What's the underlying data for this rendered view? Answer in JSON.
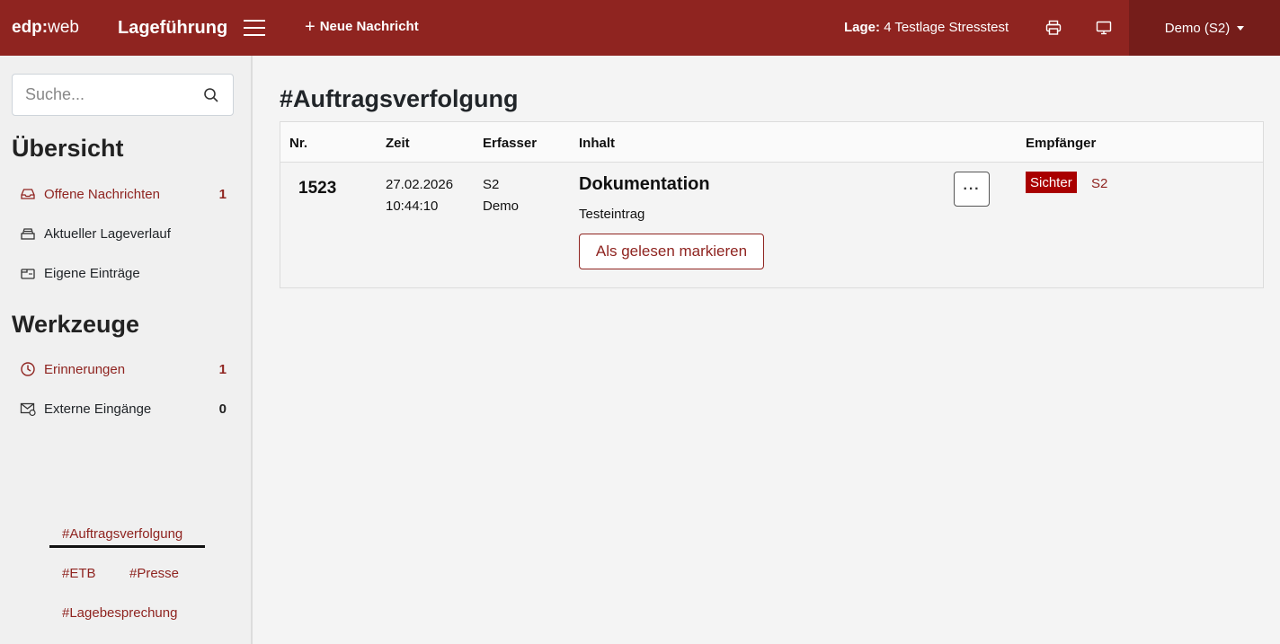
{
  "header": {
    "brand_bold": "edp:",
    "brand_rest": "web",
    "app_title": "Lageführung",
    "new_message": "Neue Nachricht",
    "lage_label": "Lage:",
    "lage_value": "4 Testlage Stresstest",
    "user": "Demo (S2)",
    "icons": [
      "menu-icon",
      "plus-icon",
      "printer-icon",
      "monitor-icon",
      "caret-down-icon"
    ],
    "bar_color": "#8f2420"
  },
  "sidebar": {
    "search_placeholder": "Suche...",
    "overview_heading": "Übersicht",
    "overview_items": [
      {
        "label": "Offene Nachrichten",
        "count": "1",
        "icon": "inbox-icon"
      },
      {
        "label": "Aktueller Lageverlauf",
        "count": "",
        "icon": "stack-icon"
      },
      {
        "label": "Eigene Einträge",
        "count": "",
        "icon": "folder-icon"
      }
    ],
    "tools_heading": "Werkzeuge",
    "tools_items": [
      {
        "label": "Erinnerungen",
        "count": "1",
        "icon": "clock-icon"
      },
      {
        "label": "Externe Eingänge",
        "count": "0",
        "icon": "mail-icon"
      }
    ],
    "tags": [
      "#Auftragsverfolgung",
      "#ETB",
      "#Presse",
      "#Lagebesprechung"
    ]
  },
  "main": {
    "title": "#Auftragsverfolgung",
    "columns": [
      "Nr.",
      "Zeit",
      "Erfasser",
      "Inhalt",
      "Empfänger"
    ],
    "rows": [
      {
        "nr": "1523",
        "date": "27.02.2026",
        "time": "10:44:10",
        "author_unit": "S2",
        "author_name": "Demo",
        "content_title": "Dokumentation",
        "content_text": "Testeintrag",
        "mark_read": "Als gelesen markieren",
        "more": "···",
        "recipient_badge": "Sichter",
        "recipient": "S2"
      }
    ]
  }
}
